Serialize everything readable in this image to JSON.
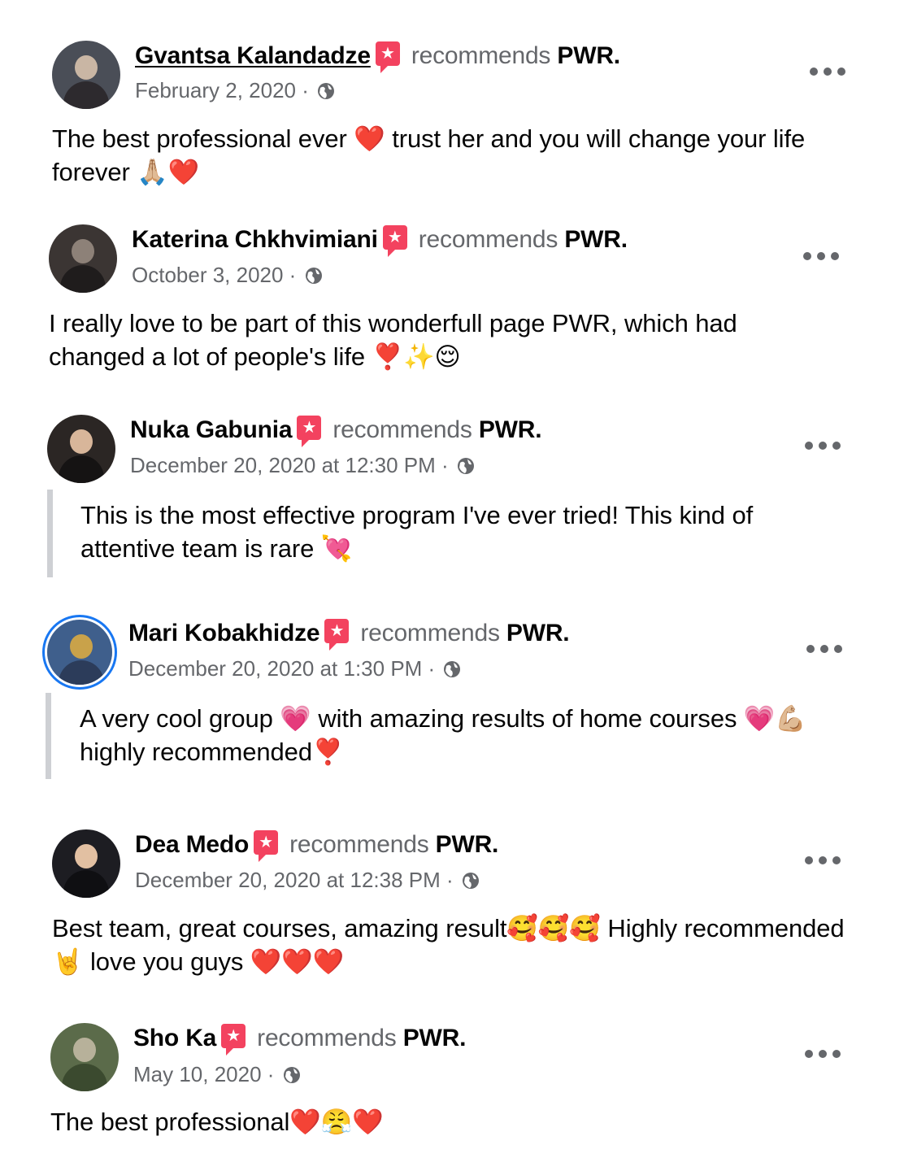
{
  "colors": {
    "text": "#050505",
    "secondary": "#65676b",
    "recommend_icon": "#f3425f",
    "avatar_ring": "#1877f2",
    "quote_bar": "#ced0d4"
  },
  "common": {
    "recommends_label": "recommends",
    "page_name": "PWR.",
    "recommend_icon_name": "recommendation-icon",
    "privacy_icon_name": "globe-icon",
    "more_icon_name": "more-options-icon"
  },
  "reviews": [
    {
      "author": "Gvantsa Kalandadze",
      "date": "February 2, 2020 ·",
      "text": "The best professional ever ❤️ trust her and you will change your life forever 🙏🏼❤️",
      "avatar_colors": [
        "#4a4e57",
        "#c9b6a4",
        "#2d2a2e"
      ]
    },
    {
      "author": "Katerina Chkhvimiani",
      "date": "October 3, 2020 ·",
      "text": "I really love to be part of this wonderfull page PWR, which had changed a lot of people's life ❣️✨😌",
      "avatar_colors": [
        "#3b3533",
        "#8d8178",
        "#1f1c1c"
      ]
    },
    {
      "author": "Nuka Gabunia",
      "date": "December 20, 2020 at 12:30 PM ·",
      "text": "This is the most effective program I've ever tried! This kind of attentive team is rare 💘",
      "avatar_colors": [
        "#2b2624",
        "#d8b69a",
        "#151313"
      ]
    },
    {
      "author": "Mari Kobakhidze",
      "date": "December 20, 2020 at 1:30 PM ·",
      "text": "A very cool group 💗 with amazing results of home courses 💗💪🏼 highly recommended❣️",
      "avatar_colors": [
        "#3f5f8c",
        "#c9a24a",
        "#2c3c5a"
      ]
    },
    {
      "author": "Dea Medo",
      "date": "December 20, 2020 at 12:38 PM ·",
      "text": "Best team, great courses, amazing result🥰🥰🥰 Highly recommended 🤘 love you guys  ❤️❤️❤️",
      "avatar_colors": [
        "#1d1d22",
        "#e2c0a2",
        "#0f0f12"
      ]
    },
    {
      "author": "Sho Ka",
      "date": "May 10, 2020 ·",
      "text": "The best professional❤️😤❤️",
      "avatar_colors": [
        "#5b6b4a",
        "#b7b19a",
        "#3b4a2f"
      ]
    }
  ]
}
